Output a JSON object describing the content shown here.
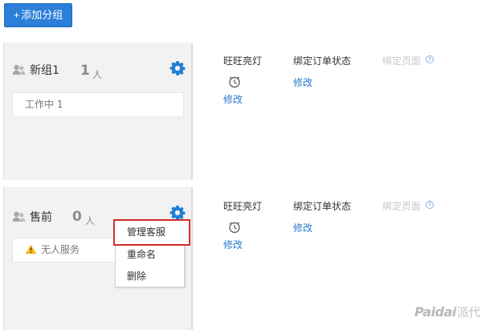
{
  "toolbar": {
    "add_group_label": "添加分组",
    "add_icon": "+"
  },
  "groups": [
    {
      "name": "新组1",
      "member_count": "1",
      "member_unit": "人",
      "status_text": "工作中 1",
      "columns": {
        "wangwang_light_label": "旺旺亮灯",
        "bind_order_status_label": "绑定订单状态",
        "bind_page_label": "绑定页面",
        "help_icon": "?",
        "wangwang_edit": "修改",
        "order_status_edit": "修改"
      }
    },
    {
      "name": "售前",
      "member_count": "0",
      "member_unit": "人",
      "status_text": "无人服务",
      "columns": {
        "wangwang_light_label": "旺旺亮灯",
        "bind_order_status_label": "绑定订单状态",
        "bind_page_label": "绑定页面",
        "help_icon": "?",
        "wangwang_edit": "修改",
        "order_status_edit": "修改"
      }
    }
  ],
  "context_menu": {
    "items": [
      "管理客服",
      "重命名",
      "删除"
    ]
  },
  "watermark": {
    "brand": "Paidai",
    "chinese": "派代"
  },
  "icons": {
    "user": "user-group-icon",
    "gear": "gear-icon",
    "lamp": "clock-lamp-icon",
    "warning": "warning-icon",
    "help": "help-icon"
  },
  "colors": {
    "primary": "#2b7fd8",
    "link": "#2677cf",
    "highlight": "#d52d2d",
    "warning": "#f5b820",
    "gear": "#1f7fd4"
  }
}
